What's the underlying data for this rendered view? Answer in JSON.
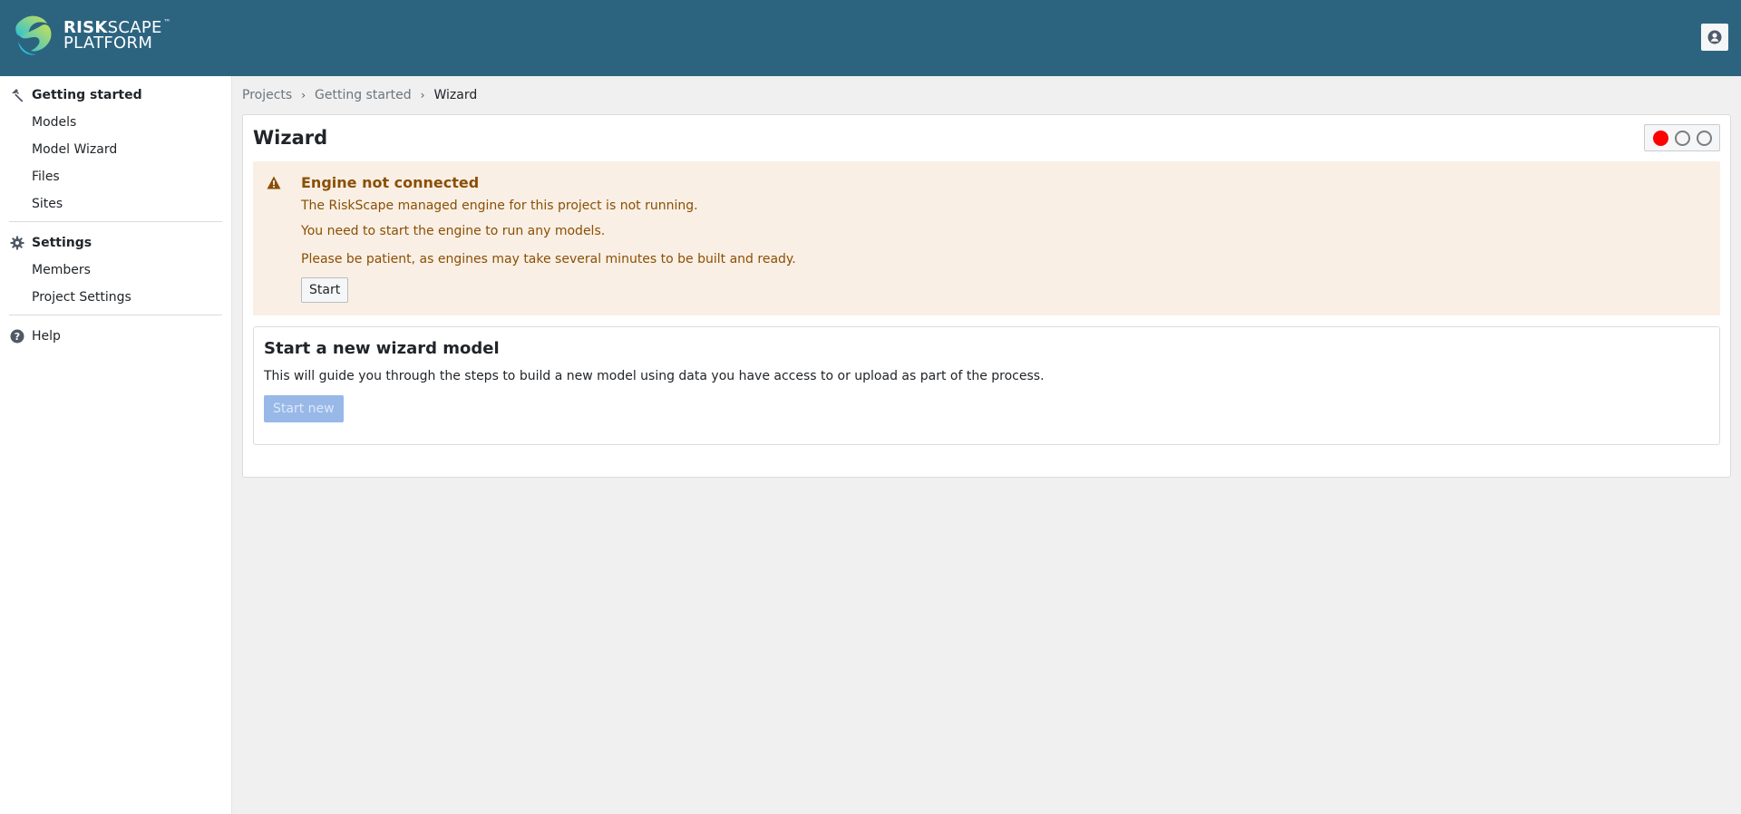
{
  "header": {
    "logo_primary": "RISK",
    "logo_secondary": "SCAPE",
    "logo_line2": "PLATFORM",
    "logo_tm": "™",
    "user_icon": "user-circle-icon"
  },
  "sidebar": {
    "sections": [
      {
        "label": "Getting started",
        "icon": "hammer-icon",
        "items": [
          "Models",
          "Model Wizard",
          "Files",
          "Sites"
        ]
      },
      {
        "label": "Settings",
        "icon": "gear-icon",
        "items": [
          "Members",
          "Project Settings"
        ]
      },
      {
        "label": "Help",
        "icon": "question-circle-icon",
        "items": []
      }
    ]
  },
  "breadcrumb": {
    "items": [
      "Projects",
      "Getting started"
    ],
    "current": "Wizard",
    "separator": "›"
  },
  "page": {
    "title": "Wizard",
    "engine_status": {
      "states": [
        "running-indicator",
        "indicator-2",
        "indicator-3"
      ],
      "active_color": "#ff0000",
      "active_index": 0
    },
    "alert": {
      "title": "Engine not connected",
      "lines": [
        "The RiskScape managed engine for this project is not running.",
        "You need to start the engine to run any models.",
        "Please be patient, as engines may take several minutes to be built and ready."
      ],
      "button_label": "Start",
      "icon": "warning-icon"
    },
    "new_model": {
      "title": "Start a new wizard model",
      "description": "This will guide you through the steps to build a new model using data you have access to or upload as part of the process.",
      "button_label": "Start new",
      "button_disabled": true
    }
  },
  "colors": {
    "header_bg": "#2c6480",
    "alert_bg": "#f9efe4",
    "alert_text": "#8a4f06",
    "primary_disabled": "#98b8e8"
  }
}
